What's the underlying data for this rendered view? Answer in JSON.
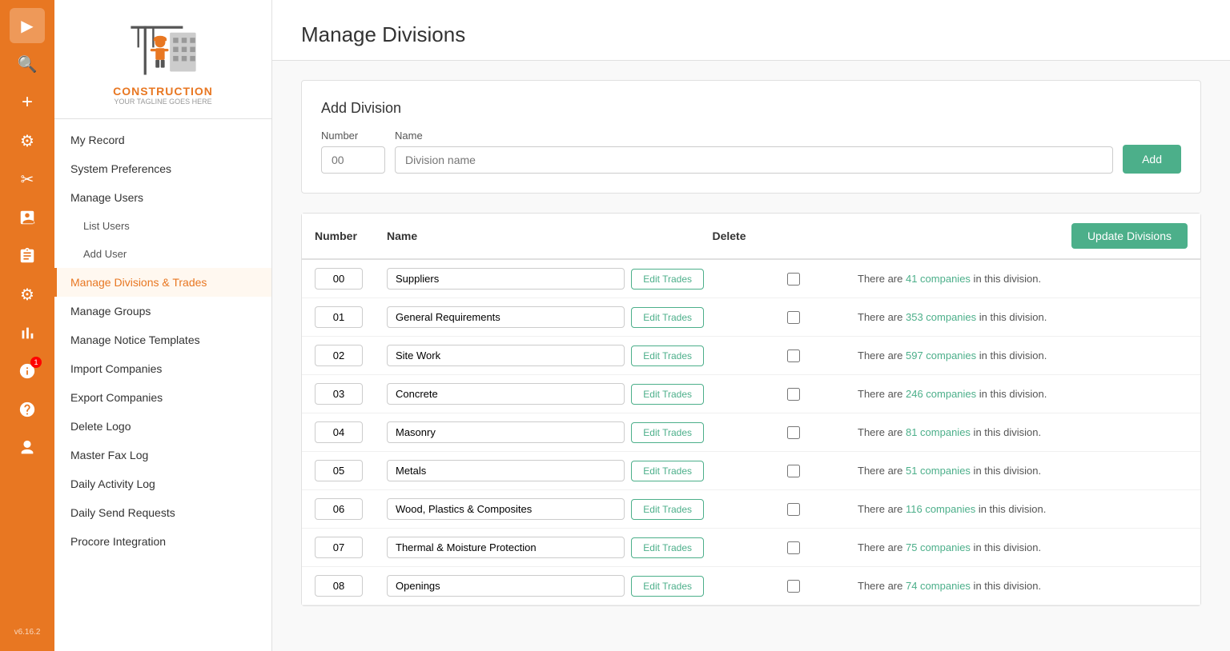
{
  "iconBar": {
    "icons": [
      {
        "name": "play-icon",
        "symbol": "▶",
        "active": true
      },
      {
        "name": "search-icon",
        "symbol": "🔍"
      },
      {
        "name": "add-icon",
        "symbol": "+"
      },
      {
        "name": "gear-icon",
        "symbol": "⚙"
      },
      {
        "name": "tools-icon",
        "symbol": "✂"
      },
      {
        "name": "contact-icon",
        "symbol": "👤"
      },
      {
        "name": "clipboard-icon",
        "symbol": "📋"
      },
      {
        "name": "settings2-icon",
        "symbol": "⚙"
      },
      {
        "name": "chart-icon",
        "symbol": "📊"
      },
      {
        "name": "info-icon",
        "symbol": "ℹ",
        "badge": "1"
      },
      {
        "name": "help-icon",
        "symbol": "?"
      },
      {
        "name": "user-icon",
        "symbol": "👤"
      }
    ],
    "version": "v6.16.2"
  },
  "sidebar": {
    "logo": {
      "text": "CONSTRUCTION",
      "tagline": "YOUR TAGLINE GOES HERE"
    },
    "navItems": [
      {
        "label": "My Record",
        "key": "my-record",
        "sub": false,
        "active": false
      },
      {
        "label": "System Preferences",
        "key": "system-preferences",
        "sub": false,
        "active": false
      },
      {
        "label": "Manage Users",
        "key": "manage-users",
        "sub": false,
        "active": false
      },
      {
        "label": "List Users",
        "key": "list-users",
        "sub": true,
        "active": false
      },
      {
        "label": "Add User",
        "key": "add-user",
        "sub": true,
        "active": false
      },
      {
        "label": "Manage Divisions & Trades",
        "key": "manage-divisions",
        "sub": false,
        "active": true
      },
      {
        "label": "Manage Groups",
        "key": "manage-groups",
        "sub": false,
        "active": false
      },
      {
        "label": "Manage Notice Templates",
        "key": "manage-notice-templates",
        "sub": false,
        "active": false
      },
      {
        "label": "Import Companies",
        "key": "import-companies",
        "sub": false,
        "active": false
      },
      {
        "label": "Export Companies",
        "key": "export-companies",
        "sub": false,
        "active": false
      },
      {
        "label": "Delete Logo",
        "key": "delete-logo",
        "sub": false,
        "active": false
      },
      {
        "label": "Master Fax Log",
        "key": "master-fax-log",
        "sub": false,
        "active": false
      },
      {
        "label": "Daily Activity Log",
        "key": "daily-activity-log",
        "sub": false,
        "active": false
      },
      {
        "label": "Daily Send Requests",
        "key": "daily-send-requests",
        "sub": false,
        "active": false
      },
      {
        "label": "Procore Integration",
        "key": "procore-integration",
        "sub": false,
        "active": false
      }
    ]
  },
  "page": {
    "title": "Manage Divisions",
    "addDivision": {
      "cardTitle": "Add Division",
      "numberLabel": "Number",
      "nameLabel": "Name",
      "numberPlaceholder": "00",
      "namePlaceholder": "Division name",
      "addButtonLabel": "Add"
    },
    "table": {
      "headers": {
        "number": "Number",
        "name": "Name",
        "delete": "Delete",
        "updateButton": "Update Divisions"
      },
      "rows": [
        {
          "number": "00",
          "name": "Suppliers",
          "companiesCount": "41",
          "hasTrades": true
        },
        {
          "number": "01",
          "name": "General Requirements",
          "companiesCount": "353",
          "hasTrades": true
        },
        {
          "number": "02",
          "name": "Site Work",
          "companiesCount": "597",
          "hasTrades": true
        },
        {
          "number": "03",
          "name": "Concrete",
          "companiesCount": "246",
          "hasTrades": true
        },
        {
          "number": "04",
          "name": "Masonry",
          "companiesCount": "81",
          "hasTrades": true
        },
        {
          "number": "05",
          "name": "Metals",
          "companiesCount": "51",
          "hasTrades": true
        },
        {
          "number": "06",
          "name": "Wood, Plastics & Composites",
          "companiesCount": "116",
          "hasTrades": true
        },
        {
          "number": "07",
          "name": "Thermal & Moisture Protection",
          "companiesCount": "75",
          "hasTrades": true
        },
        {
          "number": "08",
          "name": "Openings",
          "companiesCount": "74",
          "hasTrades": true
        }
      ],
      "editTradesLabel": "Edit Trades",
      "companiesPrefix": "There are ",
      "companiesSuffix": " in this division."
    }
  }
}
